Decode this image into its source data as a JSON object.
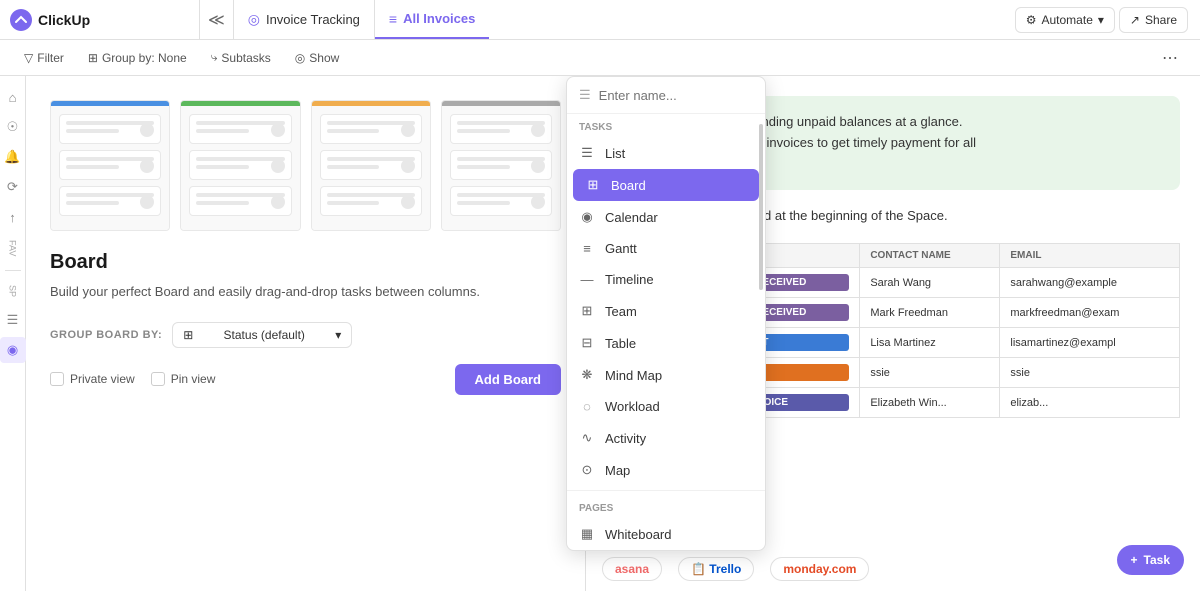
{
  "topbar": {
    "logo_text": "ClickUp",
    "collapse_icon": "≪",
    "breadcrumb": {
      "icon": "◎",
      "label": "Invoice Tracking"
    },
    "tab": {
      "icon": "≡",
      "label": "All Invoices"
    },
    "buttons": {
      "automate": "Automate",
      "share": "Share"
    }
  },
  "toolbar2": {
    "filter": "Filter",
    "group_by": "Group by: None",
    "subtasks": "Subtasks",
    "show": "Show"
  },
  "sidebar": {
    "icons": [
      "⌂",
      "☉",
      "🔔",
      "⟳",
      "↑"
    ],
    "section_labels": [
      "FAV",
      "SP"
    ],
    "extra_icons": [
      "☰",
      "◉"
    ]
  },
  "board_preview": {
    "columns": [
      {
        "color": "blue"
      },
      {
        "color": "green"
      },
      {
        "color": "yellow"
      },
      {
        "color": "gray"
      }
    ],
    "title": "Board",
    "description": "Build your perfect Board and easily drag-and-drop tasks between columns.",
    "group_by_label": "GROUP BOARD BY:",
    "group_by_value": "Status (default)",
    "checkboxes": [
      {
        "label": "Private view",
        "checked": false
      },
      {
        "label": "Pin view",
        "checked": false
      }
    ],
    "add_button": "Add Board"
  },
  "dropdown": {
    "search_placeholder": "Enter name...",
    "sections": [
      {
        "label": "TASKS",
        "items": [
          {
            "icon": "☰",
            "label": "List",
            "active": false
          },
          {
            "icon": "⊞",
            "label": "Board",
            "active": true
          },
          {
            "icon": "◉",
            "label": "Calendar",
            "active": false
          },
          {
            "icon": "≡",
            "label": "Gantt",
            "active": false
          },
          {
            "icon": "—",
            "label": "Timeline",
            "active": false
          },
          {
            "icon": "⊞",
            "label": "Team",
            "active": false
          },
          {
            "icon": "⊞",
            "label": "Table",
            "active": false
          },
          {
            "icon": "❋",
            "label": "Mind Map",
            "active": false
          },
          {
            "icon": "◌",
            "label": "Workload",
            "active": false
          },
          {
            "icon": "∿",
            "label": "Activity",
            "active": false
          },
          {
            "icon": "⊙",
            "label": "Map",
            "active": false
          }
        ]
      },
      {
        "label": "PAGES",
        "items": [
          {
            "icon": "▦",
            "label": "Whiteboard",
            "active": false
          }
        ]
      }
    ]
  },
  "right_panel": {
    "intro_text": "s and understand outstanding unpaid balances at a glance.\nvith contacts on overdue invoices to get timely payment for all\noming invoices are due.",
    "guide_text": "t the Template Guide located at the beginning of the Space.",
    "table": {
      "headers": [
        "STATUS",
        "CONTACT NAME",
        "EMAIL"
      ],
      "rows": [
        {
          "status": "PARTIAL PAYMENT RECEIVED",
          "status_class": "status-partial",
          "contact": "Sarah Wang",
          "email": "sarahwang@example"
        },
        {
          "status": "PARTIAL PAYMENT RECEIVED",
          "status_class": "status-partial",
          "contact": "Mark Freedman",
          "email": "markfreedman@exam"
        },
        {
          "status": "INVOICE SENT",
          "status_class": "status-invoice-sent",
          "contact": "Lisa Martinez",
          "email": "lisamartinez@exampl"
        },
        {
          "status": "OVERDUE",
          "status_class": "status-overdue",
          "contact": "ssie",
          "email": "ssie"
        },
        {
          "status": "GENERATING INVOICE",
          "status_class": "status-generating",
          "contact": "Elizabeth Win...",
          "email": "elizab..."
        }
      ]
    },
    "logos": [
      {
        "label": "asana",
        "class": "logo-asana"
      },
      {
        "label": "Trello",
        "class": "logo-trello"
      },
      {
        "label": "monday.com",
        "class": "logo-monday"
      }
    ]
  },
  "task_button": {
    "icon": "+",
    "label": "Task"
  }
}
